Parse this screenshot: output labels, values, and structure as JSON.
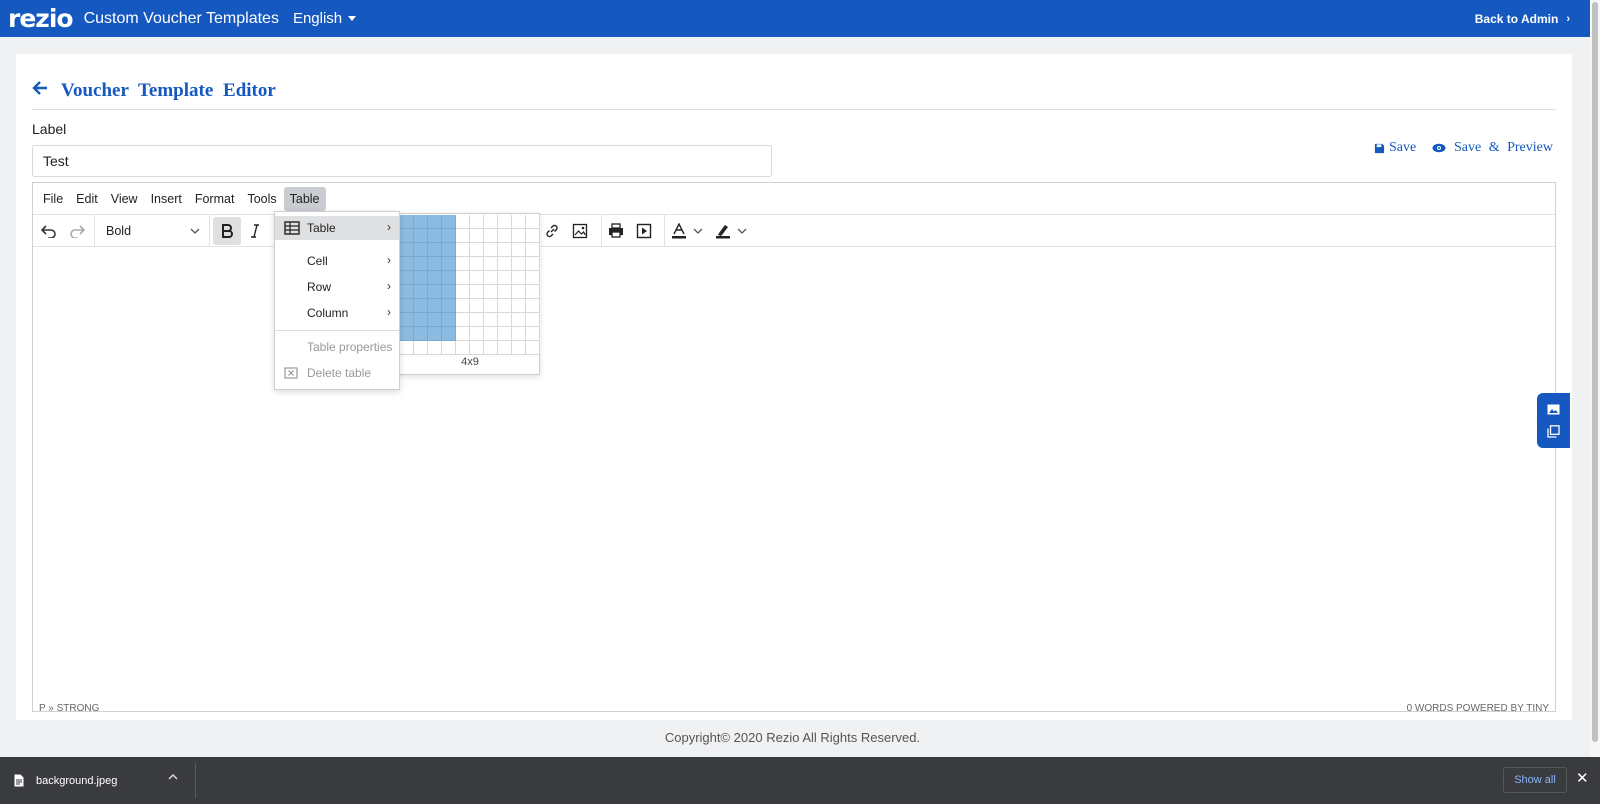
{
  "topbar": {
    "logo": "rezio",
    "app_title": "Custom Voucher Templates",
    "language": "English",
    "back_to_admin": "Back to Admin",
    "bg_color": "#1558c0"
  },
  "page": {
    "title": "Voucher Template Editor",
    "label_caption": "Label",
    "label_value": "Test",
    "save_label": "Save",
    "save_preview_label": "Save & Preview"
  },
  "editor": {
    "menus": [
      "File",
      "Edit",
      "View",
      "Insert",
      "Format",
      "Tools",
      "Table"
    ],
    "active_menu": "Table",
    "block_format": "Bold",
    "status_left": "P » STRONG",
    "status_right": "0 WORDS  POWERED BY TINY"
  },
  "table_menu": {
    "items": [
      {
        "label": "Table",
        "icon": "table-icon",
        "submenu": true
      },
      {
        "label": "Cell",
        "submenu": true
      },
      {
        "label": "Row",
        "submenu": true
      },
      {
        "label": "Column",
        "submenu": true
      },
      {
        "label": "Table properties",
        "disabled": true
      },
      {
        "label": "Delete table",
        "icon": "delete-table-icon",
        "disabled": true
      }
    ]
  },
  "grid_picker": {
    "selected_cols": 4,
    "selected_rows": 9,
    "size_label": "4x9"
  },
  "footer": {
    "copyright": "Copyright© 2020 Rezio All Rights Reserved."
  },
  "download_bar": {
    "filename": "background.jpeg",
    "show_all": "Show all"
  }
}
